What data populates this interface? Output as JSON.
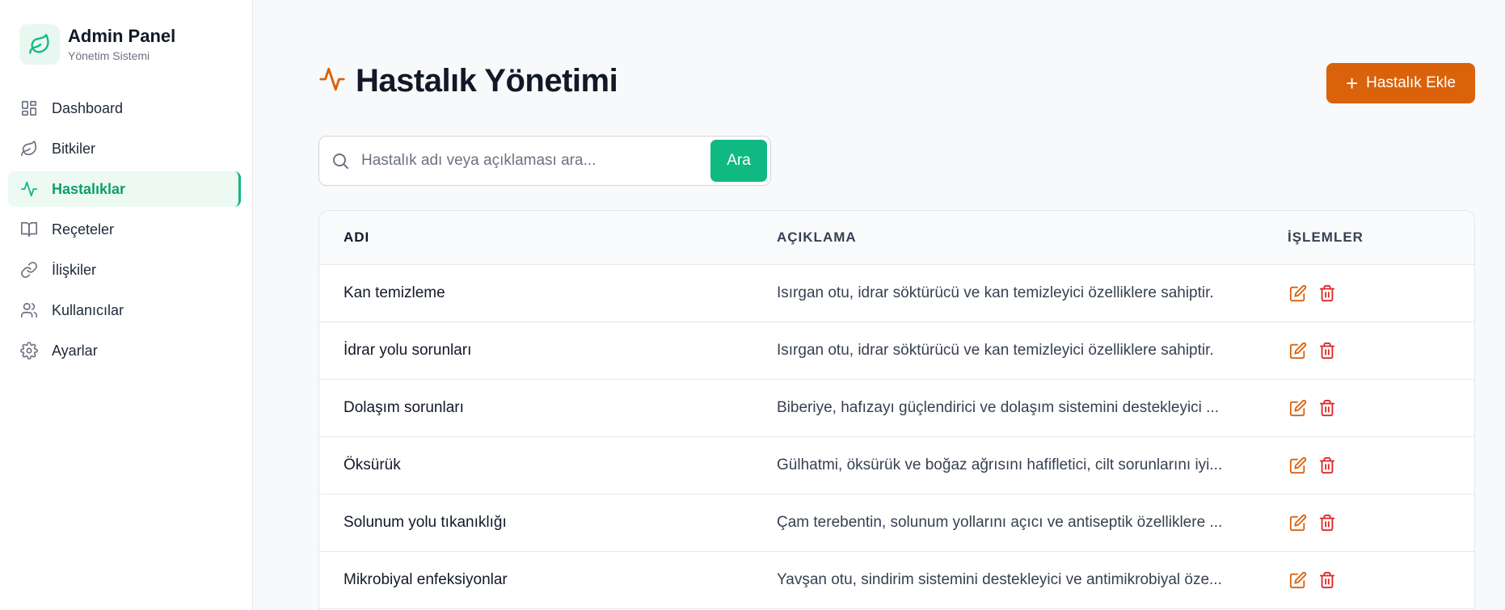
{
  "brand": {
    "title": "Admin Panel",
    "subtitle": "Yönetim Sistemi",
    "logo_icon": "leaf-icon"
  },
  "nav": [
    {
      "label": "Dashboard",
      "icon": "grid-icon",
      "active": false
    },
    {
      "label": "Bitkiler",
      "icon": "leaf-icon",
      "active": false
    },
    {
      "label": "Hastalıklar",
      "icon": "activity-icon",
      "active": true
    },
    {
      "label": "Reçeteler",
      "icon": "book-icon",
      "active": false
    },
    {
      "label": "İlişkiler",
      "icon": "link-icon",
      "active": false
    },
    {
      "label": "Kullanıcılar",
      "icon": "users-icon",
      "active": false
    },
    {
      "label": "Ayarlar",
      "icon": "gear-icon",
      "active": false
    }
  ],
  "page": {
    "title": "Hastalık Yönetimi",
    "add_button": "Hastalık Ekle"
  },
  "search": {
    "placeholder": "Hastalık adı veya açıklaması ara...",
    "value": "",
    "button": "Ara"
  },
  "table": {
    "headers": {
      "name": "ADI",
      "description": "AÇIKLAMA",
      "actions": "İŞLEMLER"
    },
    "rows": [
      {
        "name": "Kan temizleme",
        "description": "Isırgan otu, idrar söktürücü ve kan temizleyici özelliklere sahiptir."
      },
      {
        "name": "İdrar yolu sorunları",
        "description": "Isırgan otu, idrar söktürücü ve kan temizleyici özelliklere sahiptir."
      },
      {
        "name": "Dolaşım sorunları",
        "description": "Biberiye, hafızayı güçlendirici ve dolaşım sistemini destekleyici ..."
      },
      {
        "name": "Öksürük",
        "description": "Gülhatmi, öksürük ve boğaz ağrısını hafifletici, cilt sorunlarını iyi..."
      },
      {
        "name": "Solunum yolu tıkanıklığı",
        "description": "Çam terebentin, solunum yollarını açıcı ve antiseptik özelliklere ..."
      },
      {
        "name": "Mikrobiyal enfeksiyonlar",
        "description": "Yavşan otu, sindirim sistemini destekleyici ve antimikrobiyal öze..."
      }
    ]
  },
  "colors": {
    "primary": "#10b981",
    "accent": "#d9620a",
    "danger": "#dc2626",
    "edit": "#d9620a"
  }
}
